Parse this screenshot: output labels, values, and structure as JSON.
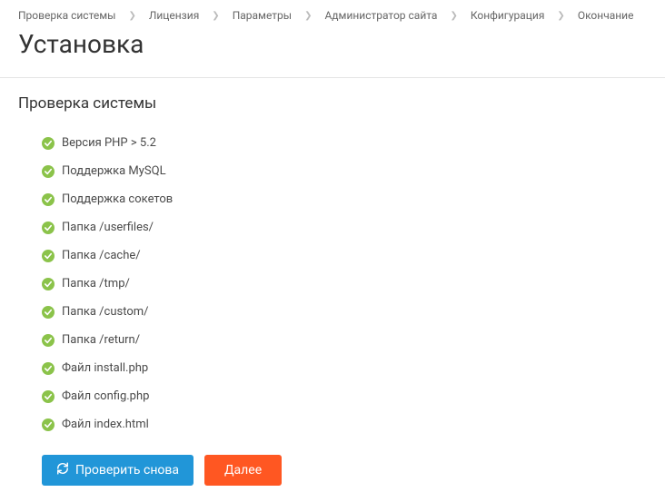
{
  "breadcrumb": {
    "items": [
      {
        "label": "Проверка системы"
      },
      {
        "label": "Лицензия"
      },
      {
        "label": "Параметры"
      },
      {
        "label": "Администратор сайта"
      },
      {
        "label": "Конфигурация"
      },
      {
        "label": "Окончание"
      }
    ]
  },
  "page_title": "Установка",
  "section_title": "Проверка системы",
  "checks": [
    {
      "status": "ok",
      "label": "Версия PHP > 5.2"
    },
    {
      "status": "ok",
      "label": "Поддержка MySQL"
    },
    {
      "status": "ok",
      "label": "Поддержка сокетов"
    },
    {
      "status": "ok",
      "label": "Папка /userfiles/"
    },
    {
      "status": "ok",
      "label": "Папка /cache/"
    },
    {
      "status": "ok",
      "label": "Папка /tmp/"
    },
    {
      "status": "ok",
      "label": "Папка /custom/"
    },
    {
      "status": "ok",
      "label": "Папка /return/"
    },
    {
      "status": "ok",
      "label": "Файл install.php"
    },
    {
      "status": "ok",
      "label": "Файл config.php"
    },
    {
      "status": "ok",
      "label": "Файл index.html"
    }
  ],
  "buttons": {
    "recheck_label": "Проверить снова",
    "next_label": "Далее"
  },
  "colors": {
    "success": "#8bc34a",
    "primary": "#2196d8",
    "accent": "#ff5722"
  }
}
